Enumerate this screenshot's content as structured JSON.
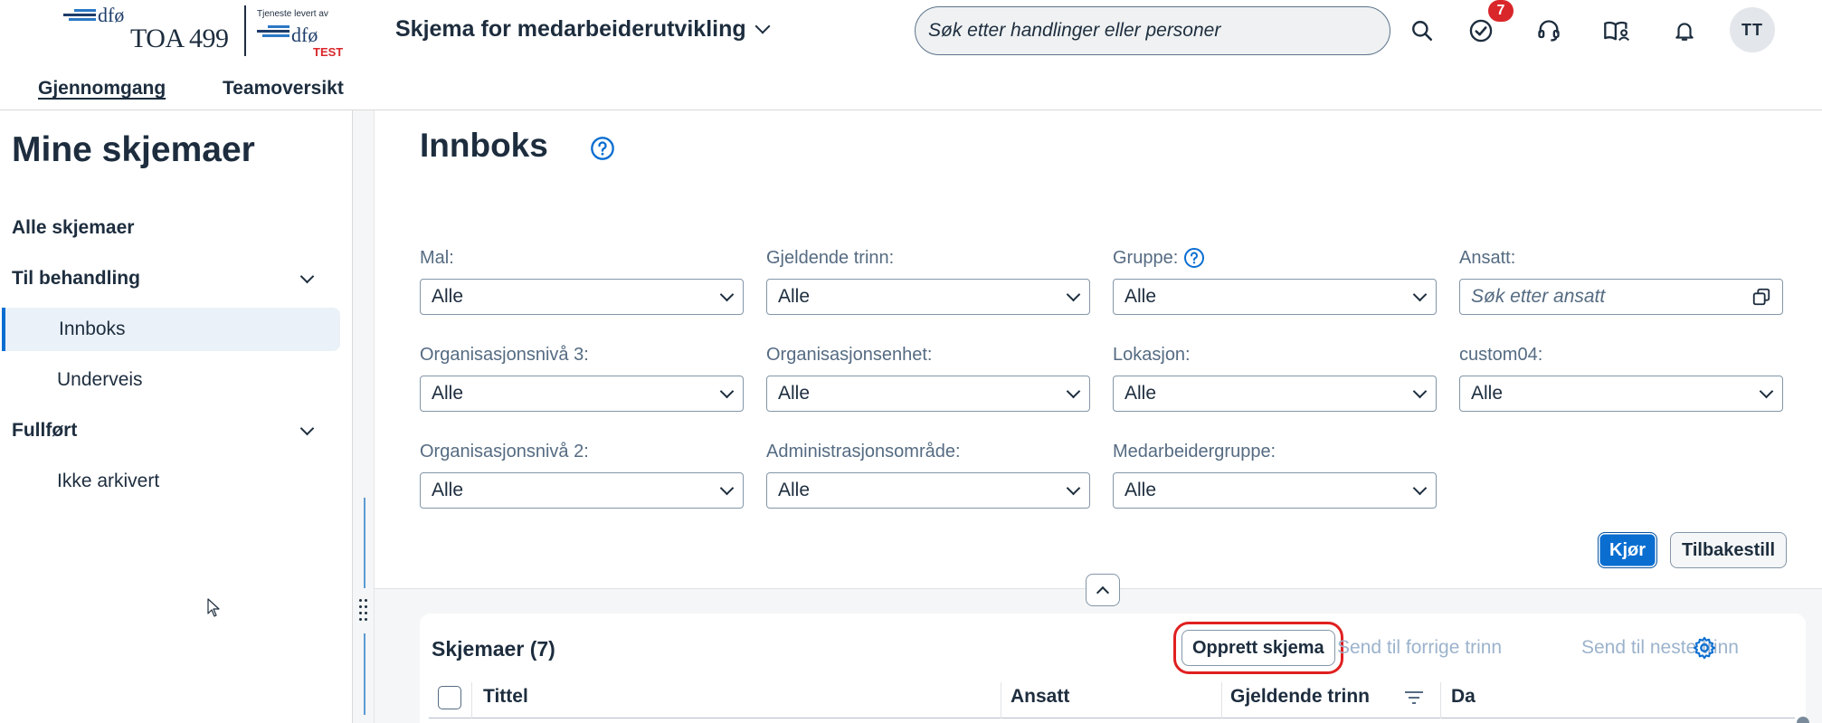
{
  "header": {
    "logo": {
      "org": "dfø",
      "unit": "TOA 499",
      "provided_by": "Tjeneste levert av",
      "provider": "dfø",
      "env": "TEST"
    },
    "app_title": "Skjema for medarbeiderutvikling",
    "search_placeholder": "Søk etter handlinger eller personer",
    "icons": [
      "search-icon",
      "task-check-icon",
      "headset-icon",
      "book-user-icon",
      "bell-icon"
    ],
    "notification_count": "7",
    "avatar_initials": "TT"
  },
  "top_nav": {
    "items": [
      "Gjennomgang",
      "Teamoversikt"
    ],
    "active": "Gjennomgang"
  },
  "sidebar": {
    "title": "Mine skjemaer",
    "items": [
      {
        "label": "Alle skjemaer",
        "type": "group"
      },
      {
        "label": "Til behandling",
        "type": "group",
        "expandable": true
      },
      {
        "label": "Innboks",
        "type": "sub",
        "selected": true
      },
      {
        "label": "Underveis",
        "type": "sub"
      },
      {
        "label": "Fullført",
        "type": "group",
        "expandable": true
      },
      {
        "label": "Ikke arkivert",
        "type": "sub"
      }
    ]
  },
  "main": {
    "title": "Innboks",
    "filters": [
      {
        "label": "Mal:",
        "value": "Alle"
      },
      {
        "label": "Gjeldende trinn:",
        "value": "Alle"
      },
      {
        "label": "Gruppe:",
        "value": "Alle",
        "help": true
      },
      {
        "label": "Ansatt:",
        "placeholder": "Søk etter ansatt",
        "type": "input"
      },
      {
        "label": "Organisasjonsnivå 3:",
        "value": "Alle"
      },
      {
        "label": "Organisasjonsenhet:",
        "value": "Alle"
      },
      {
        "label": "Lokasjon:",
        "value": "Alle"
      },
      {
        "label": "custom04:",
        "value": "Alle"
      },
      {
        "label": "Organisasjonsnivå 2:",
        "value": "Alle"
      },
      {
        "label": "Administrasjonsområde:",
        "value": "Alle"
      },
      {
        "label": "Medarbeidergruppe:",
        "value": "Alle"
      }
    ],
    "run_label": "Kjør",
    "reset_label": "Tilbakestill",
    "table": {
      "title": "Skjemaer (7)",
      "create_label": "Opprett skjema",
      "prev_label": "Send til forrige trinn",
      "next_label": "Send til neste trinn",
      "columns": [
        "Tittel",
        "Ansatt",
        "Gjeldende trinn",
        "Da"
      ]
    }
  },
  "colors": {
    "accent": "#0a6ed1",
    "text": "#1d2d3e",
    "badge": "#d9262a",
    "highlight_outline": "#e02020"
  }
}
